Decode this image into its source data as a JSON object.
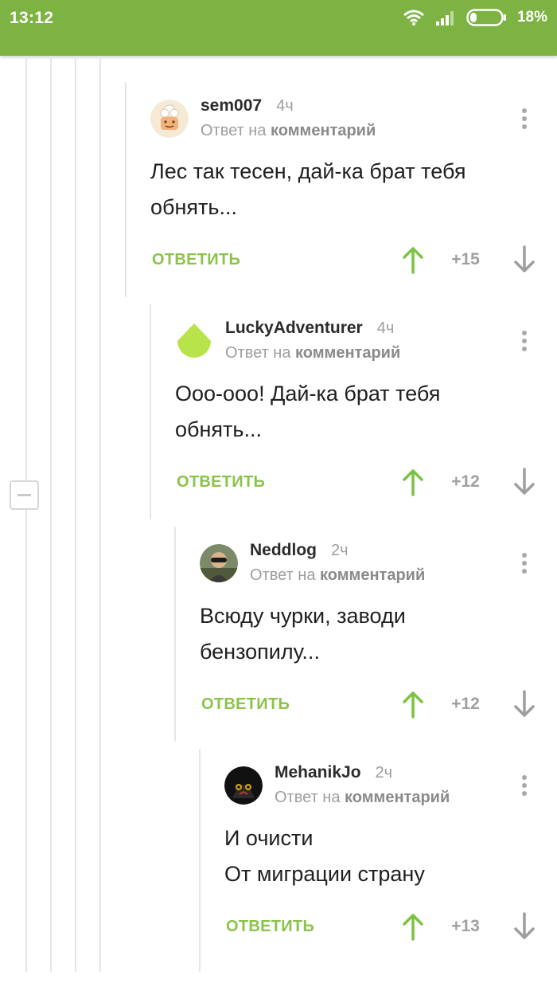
{
  "status": {
    "time": "13:12",
    "battery": "18%"
  },
  "comments": [
    {
      "author": "sem007",
      "time": "4ч",
      "reply_prefix": "Ответ на",
      "reply_link": "комментарий",
      "line1": "Лес так тесен, дай-ка брат тебя",
      "line2": "обнять...",
      "reply_label": "ОТВЕТИТЬ",
      "score": "+15",
      "avatar": "chef-avatar"
    },
    {
      "author": "LuckyAdventurer",
      "time": "4ч",
      "reply_prefix": "Ответ на",
      "reply_link": "комментарий",
      "line1": "Ооо-ооо! Дай-ка брат тебя",
      "line2": "обнять...",
      "reply_label": "ОТВЕТИТЬ",
      "score": "+12",
      "avatar": "green-drop-avatar"
    },
    {
      "author": "Neddlog",
      "time": "2ч",
      "reply_prefix": "Ответ на",
      "reply_link": "комментарий",
      "line1": "Всюду чурки, заводи",
      "line2": "бензопилу...",
      "reply_label": "ОТВЕТИТЬ",
      "score": "+12",
      "avatar": "photo-avatar"
    },
    {
      "author": "MehanikJo",
      "time": "2ч",
      "reply_prefix": "Ответ на",
      "reply_link": "комментарий",
      "line1": "И очисти",
      "line2": "От миграции страну",
      "reply_label": "ОТВЕТИТЬ",
      "score": "+13",
      "avatar": "mask-avatar"
    }
  ],
  "colors": {
    "statusbar": "#7cb342",
    "accent": "#8bc34a",
    "vote_up": "#7cc242",
    "muted": "#9e9e9e"
  }
}
